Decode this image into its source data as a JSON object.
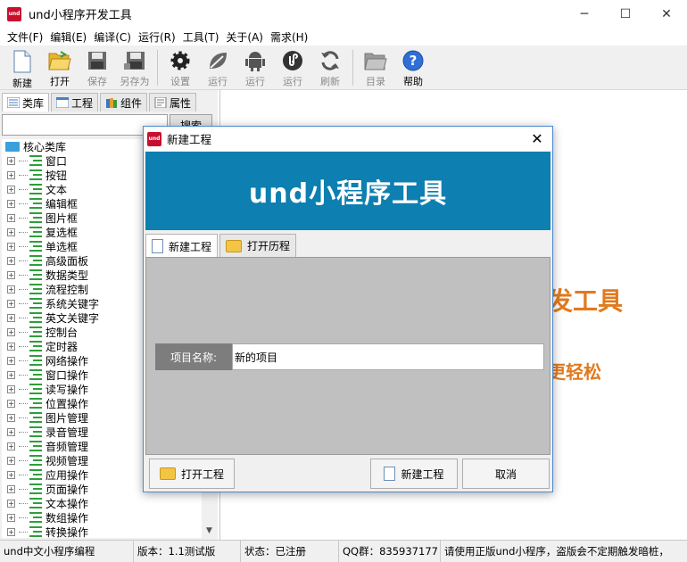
{
  "window": {
    "title": "und小程序开发工具",
    "logo_text": "und",
    "controls": {
      "minimize": "─",
      "maximize": "☐",
      "close": "✕"
    }
  },
  "menu": [
    "文件(F)",
    "编辑(E)",
    "编译(C)",
    "运行(R)",
    "工具(T)",
    "关于(A)",
    "需求(H)"
  ],
  "toolbar": {
    "new": "新建",
    "open": "打开",
    "save": "保存",
    "save_as": "另存为",
    "settings": "设置",
    "run1": "运行",
    "run2": "运行",
    "run3": "运行",
    "refresh": "刷新",
    "directory": "目录",
    "help": "帮助"
  },
  "left_panel": {
    "tabs": [
      "类库",
      "工程",
      "组件",
      "属性"
    ],
    "search_value": "",
    "search_button": "搜索",
    "tree_root": "核心类库",
    "tree_items": [
      "窗口",
      "按钮",
      "文本",
      "编辑框",
      "图片框",
      "复选框",
      "单选框",
      "高级面板",
      "数据类型",
      "流程控制",
      "系统关键字",
      "英文关键字",
      "控制台",
      "定时器",
      "网络操作",
      "窗口操作",
      "读写操作",
      "位置操作",
      "图片管理",
      "录音管理",
      "音频管理",
      "视频管理",
      "应用操作",
      "页面操作",
      "文本操作",
      "数组操作",
      "转换操作"
    ]
  },
  "main": {
    "bg_title_fragment": "发工具",
    "bg_sub_fragment": "更轻松"
  },
  "statusbar": {
    "app": "und中文小程序编程",
    "version": "版本：1.1测试版",
    "status": "状态：已注册",
    "qq": "QQ群：835937177",
    "notice": "请使用正版und小程序，盗版会不定期触发暗桩，"
  },
  "dialog": {
    "title": "新建工程",
    "logo_text": "und",
    "banner": "und小程序工具",
    "tabs": [
      "新建工程",
      "打开历程"
    ],
    "field_label": "项目名称:",
    "field_value": "新的项目",
    "buttons": {
      "open_project": "打开工程",
      "new_project": "新建工程",
      "cancel": "取消"
    }
  },
  "colors": {
    "logo_red": "#c8102e",
    "banner_blue": "#0d7fb0",
    "accent_orange": "#e07a1e",
    "tree_icon_green": "#2e9e3a"
  }
}
